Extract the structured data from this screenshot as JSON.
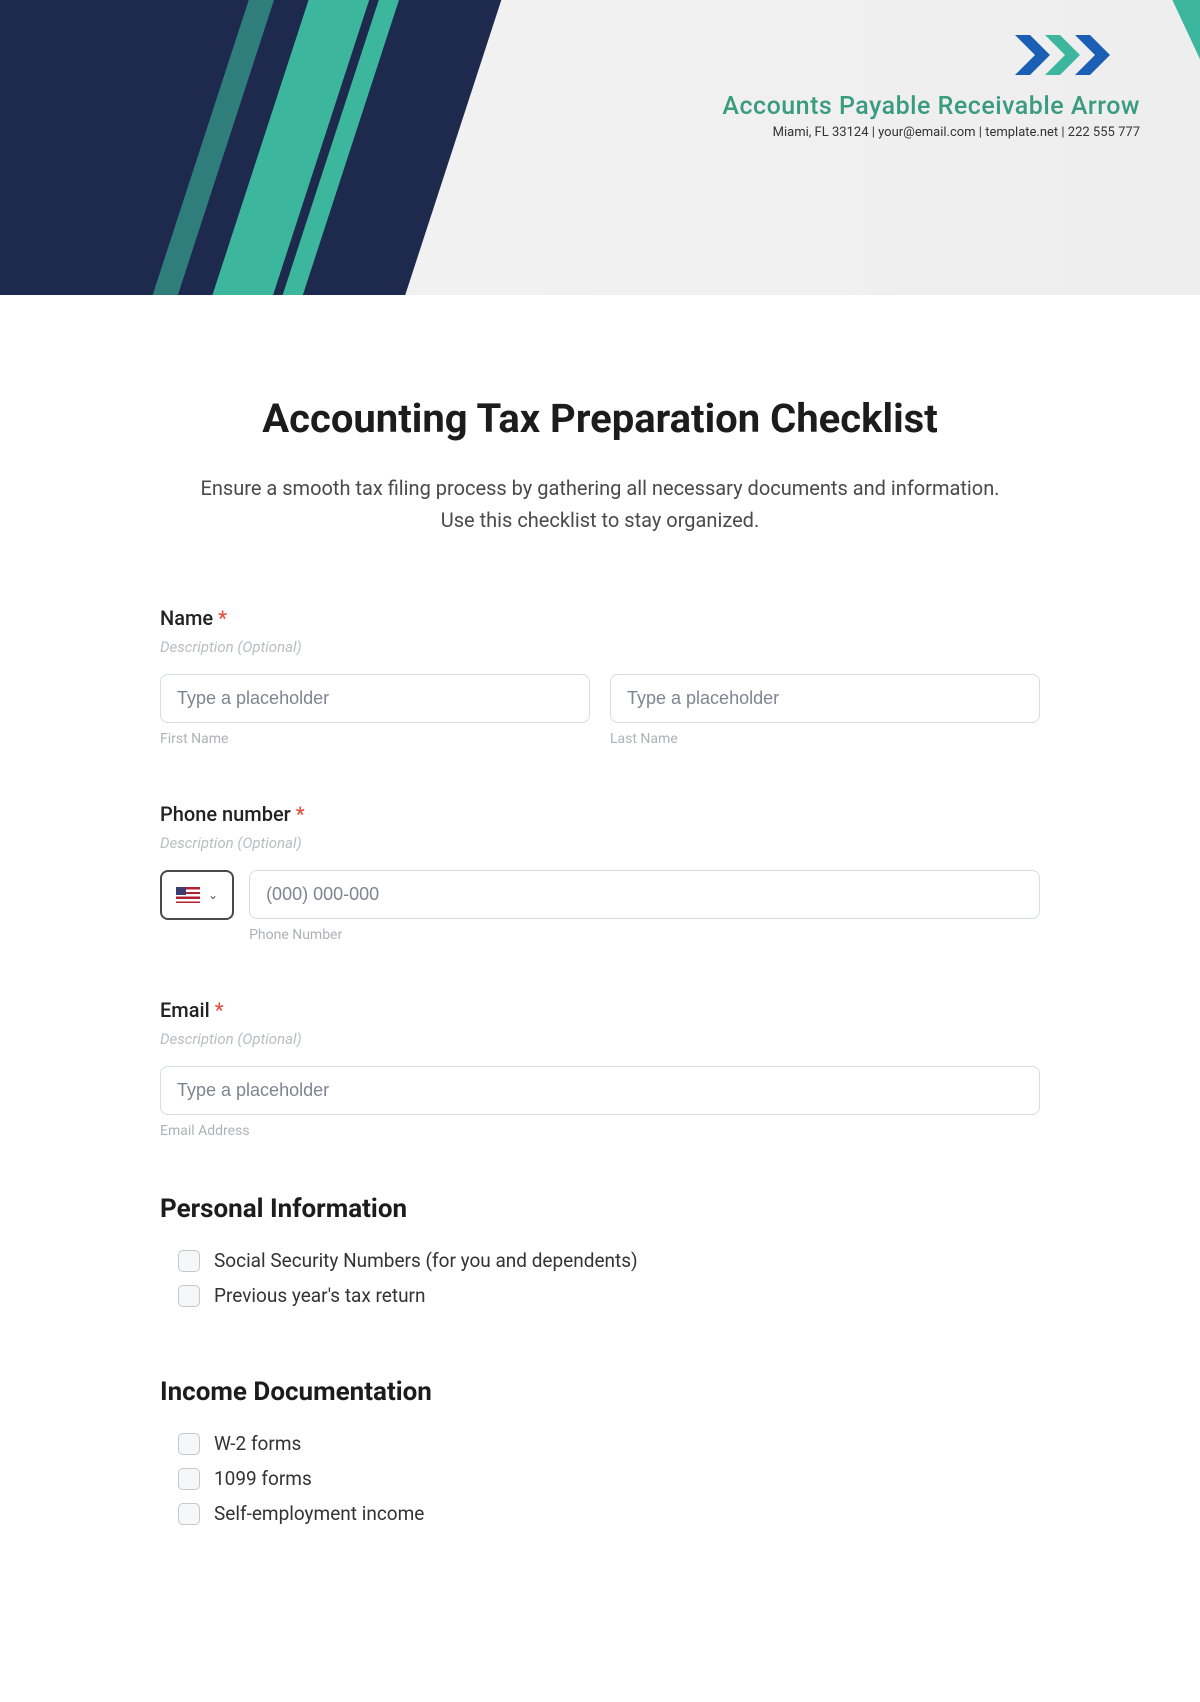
{
  "company": {
    "name": "Accounts Payable Receivable Arrow",
    "contact": "Miami, FL 33124 | your@email.com | template.net | 222 555 777"
  },
  "page": {
    "title": "Accounting Tax Preparation Checklist",
    "subtitle": "Ensure a smooth tax filing process by gathering all necessary documents and information. Use this checklist to stay organized."
  },
  "fields": {
    "name": {
      "label": "Name",
      "required": "*",
      "description": "Description (Optional)",
      "first_placeholder": "Type a placeholder",
      "last_placeholder": "Type a placeholder",
      "first_sublabel": "First Name",
      "last_sublabel": "Last Name"
    },
    "phone": {
      "label": "Phone number",
      "required": "*",
      "description": "Description (Optional)",
      "placeholder": "(000) 000-000",
      "sublabel": "Phone Number"
    },
    "email": {
      "label": "Email",
      "required": "*",
      "description": "Description (Optional)",
      "placeholder": "Type a placeholder",
      "sublabel": "Email Address"
    }
  },
  "sections": {
    "personal": {
      "heading": "Personal Information",
      "items": [
        "Social Security Numbers (for you and dependents)",
        "Previous year's tax return"
      ]
    },
    "income": {
      "heading": "Income Documentation",
      "items": [
        "W-2 forms",
        "1099 forms",
        "Self-employment income"
      ]
    }
  }
}
